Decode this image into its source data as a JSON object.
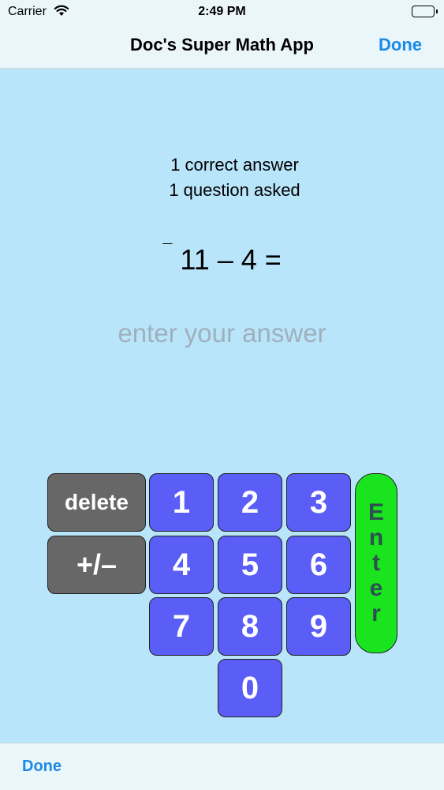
{
  "status_bar": {
    "carrier": "Carrier",
    "time": "2:49 PM"
  },
  "nav": {
    "title": "Doc's Super Math App",
    "done_label": "Done"
  },
  "stats": {
    "correct": "1 correct answer",
    "asked": "1 question asked"
  },
  "question": {
    "sign": "¯",
    "expression": "11 – 4 ="
  },
  "answer": {
    "placeholder": "enter your answer"
  },
  "keypad": {
    "delete_label": "delete",
    "sign_label": "+/–",
    "digits": {
      "k0": "0",
      "k1": "1",
      "k2": "2",
      "k3": "3",
      "k4": "4",
      "k5": "5",
      "k6": "6",
      "k7": "7",
      "k8": "8",
      "k9": "9"
    },
    "enter_letters": [
      "E",
      "n",
      "t",
      "e",
      "r"
    ]
  },
  "toolbar": {
    "done_label": "Done"
  },
  "colors": {
    "background": "#b9e5fb",
    "bar": "#ebf6fb",
    "accent": "#1a8ae6",
    "digit_key": "#5a5df6",
    "function_key": "#676767",
    "enter_key": "#19e41e"
  }
}
